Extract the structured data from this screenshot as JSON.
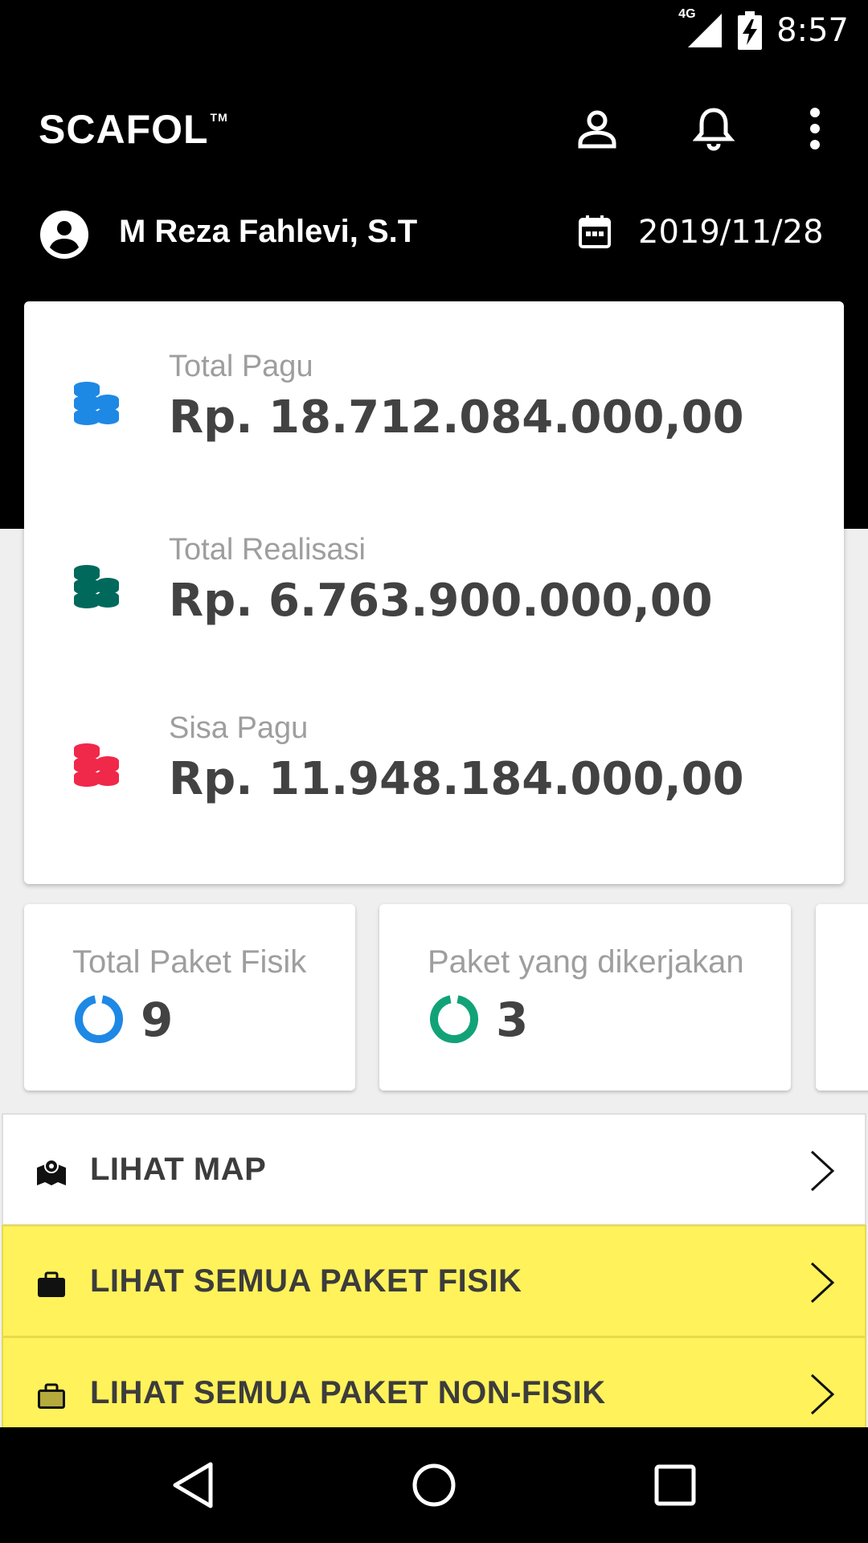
{
  "status_bar": {
    "network": "4G",
    "time": "8:57"
  },
  "app_bar": {
    "logo": "SCAFOL",
    "trademark": "TM"
  },
  "user": {
    "name": "M Reza Fahlevi, S.T",
    "date": "2019/11/28"
  },
  "summary": [
    {
      "label": "Total Pagu",
      "value": "Rp. 18.712.084.000,00",
      "icon_color": "#1e88e5"
    },
    {
      "label": "Total Realisasi",
      "value": "Rp. 6.763.900.000,00",
      "icon_color": "#00695c"
    },
    {
      "label": "Sisa Pagu",
      "value": "Rp. 11.948.184.000,00",
      "icon_color": "#f0284a"
    }
  ],
  "stats": [
    {
      "label": "Total Paket Fisik",
      "value": "9",
      "ring_color": "#1e88e5"
    },
    {
      "label": "Paket yang dikerjakan",
      "value": "3",
      "ring_color": "#11a377"
    }
  ],
  "menu": [
    {
      "label": "LIHAT MAP",
      "icon": "map-pin-icon"
    },
    {
      "label": "LIHAT SEMUA PAKET FISIK",
      "icon": "briefcase-icon"
    },
    {
      "label": "LIHAT SEMUA PAKET NON-FISIK",
      "icon": "briefcase-icon"
    }
  ],
  "colors": {
    "header_bg": "#000000",
    "highlight_yellow": "#fff25a"
  }
}
